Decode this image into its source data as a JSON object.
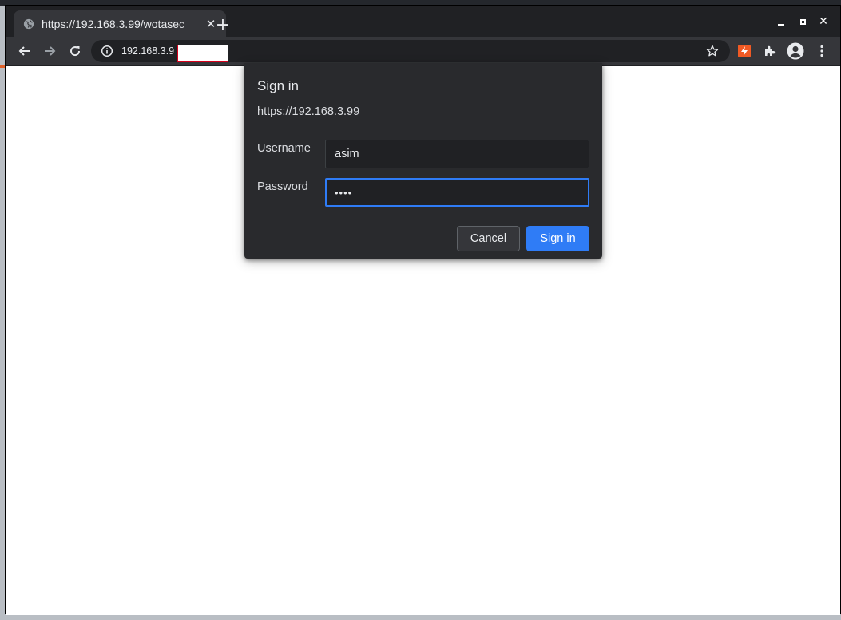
{
  "browser": {
    "tab": {
      "title": "https://192.168.3.99/wotasec",
      "favicon": "globe-icon"
    },
    "new_tab_label": "+",
    "close_tab_label": "✕",
    "omnibox": {
      "url": "192.168.3.9"
    },
    "window_controls": {
      "close_label": "✕"
    }
  },
  "dialog": {
    "title": "Sign in",
    "origin": "https://192.168.3.99",
    "username_label": "Username",
    "username_value": "asim",
    "password_label": "Password",
    "password_value": "••••",
    "cancel_label": "Cancel",
    "signin_label": "Sign in"
  },
  "colors": {
    "accent": "#2f7cf6",
    "dialog_bg": "#292a2d",
    "toolbar_bg": "#35363a",
    "extension_badge": "#f15a24"
  }
}
